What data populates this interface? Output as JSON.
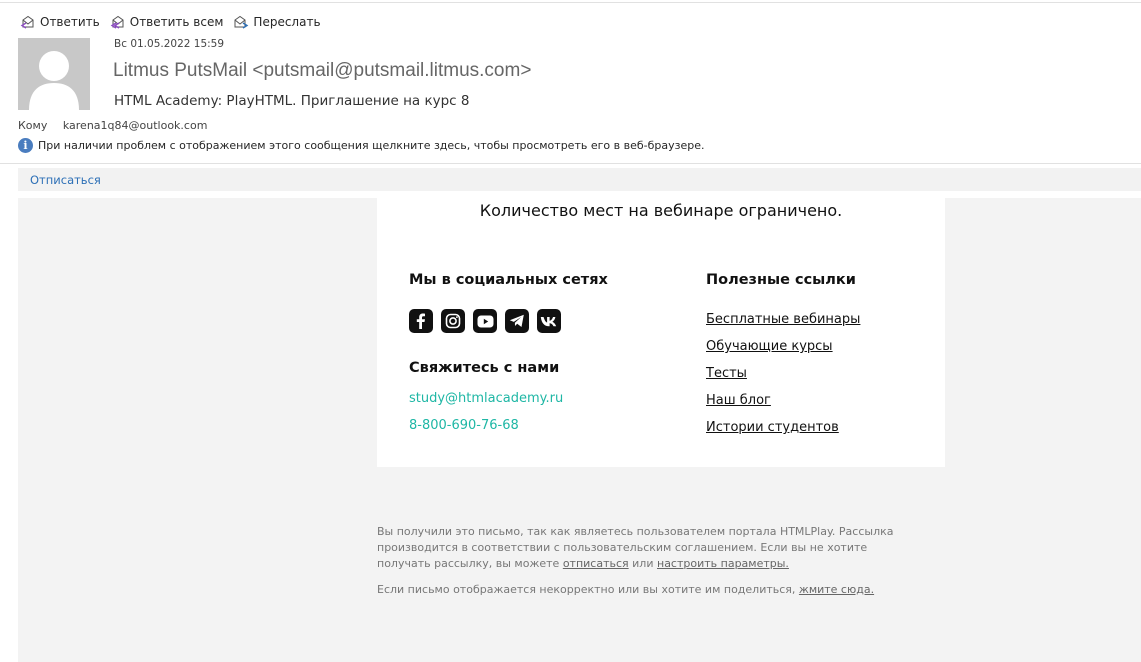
{
  "toolbar": {
    "reply": "Ответить",
    "reply_all": "Ответить всем",
    "forward": "Переслать"
  },
  "header": {
    "date": "Вс 01.05.2022 15:59",
    "sender": "Litmus PutsMail <putsmail@putsmail.litmus.com>",
    "subject": "HTML Academy: PlayHTML. Приглашение на курс 8",
    "to_label": "Кому",
    "to_address": "karena1q84@outlook.com",
    "info_text": "При наличии проблем с отображением этого сообщения щелкните здесь, чтобы просмотреть его в веб-браузере."
  },
  "unsubscribe_bar": {
    "link": "Отписаться"
  },
  "body": {
    "limited_notice": "Количество мест на вебинаре ограничено.",
    "social_title": "Мы в социальных сетях",
    "social_icons": [
      "facebook-icon",
      "instagram-icon",
      "youtube-icon",
      "telegram-icon",
      "vk-icon"
    ],
    "contact_title": "Свяжитесь с нами",
    "contact_email": "study@htmlacademy.ru",
    "contact_phone": "8-800-690-76-68",
    "links_title": "Полезные ссылки",
    "links": [
      "Бесплатные вебинары",
      "Обучающие курсы",
      "Тесты",
      "Наш блог",
      "Истории студентов"
    ],
    "accent_color": "#1fb7a5"
  },
  "footer": {
    "p1_text": "Вы получили это письмо, так как являетесь пользователем портала HTMLPlay. Рассылка производится в соответствии с пользовательским соглашением. Если вы не хотите получать рассылку, вы можете",
    "unsubscribe_link": "отписаться",
    "or_text": "или",
    "settings_link": "настроить параметры.",
    "p2_text": "Если письмо отображается некорректно или вы хотите им поделиться,",
    "share_link": "жмите сюда."
  }
}
